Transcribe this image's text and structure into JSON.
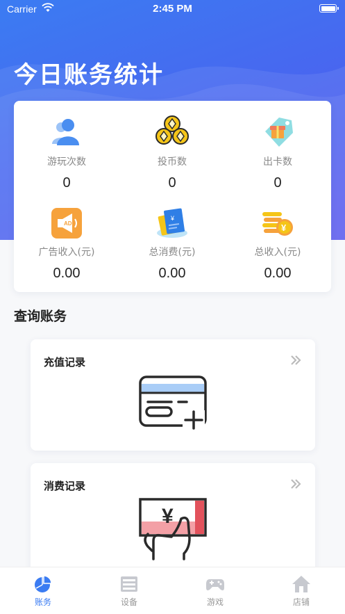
{
  "status_bar": {
    "carrier": "Carrier",
    "time": "2:45 PM"
  },
  "header": {
    "title": "今日账务统计"
  },
  "stats": [
    {
      "label": "游玩次数",
      "value": "0",
      "icon": "users-icon"
    },
    {
      "label": "投币数",
      "value": "0",
      "icon": "coins-icon"
    },
    {
      "label": "出卡数",
      "value": "0",
      "icon": "gift-tag-icon"
    },
    {
      "label": "广告收入(元)",
      "value": "0.00",
      "icon": "ad-megaphone-icon"
    },
    {
      "label": "总消费(元)",
      "value": "0.00",
      "icon": "wallet-card-icon"
    },
    {
      "label": "总收入(元)",
      "value": "0.00",
      "icon": "coin-stack-icon"
    }
  ],
  "query": {
    "section_title": "查询账务",
    "records": [
      {
        "title": "充值记录",
        "icon": "card-plus-icon"
      },
      {
        "title": "消费记录",
        "icon": "yuan-payment-icon"
      }
    ]
  },
  "tabbar": {
    "tabs": [
      {
        "label": "账务",
        "icon": "pie-chart-icon",
        "active": true
      },
      {
        "label": "设备",
        "icon": "device-icon",
        "active": false
      },
      {
        "label": "游戏",
        "icon": "gamepad-icon",
        "active": false
      },
      {
        "label": "店铺",
        "icon": "home-icon",
        "active": false
      }
    ]
  },
  "colors": {
    "primary": "#3b7cf2",
    "accent_orange": "#f6a23c",
    "gold": "#f5c518"
  }
}
